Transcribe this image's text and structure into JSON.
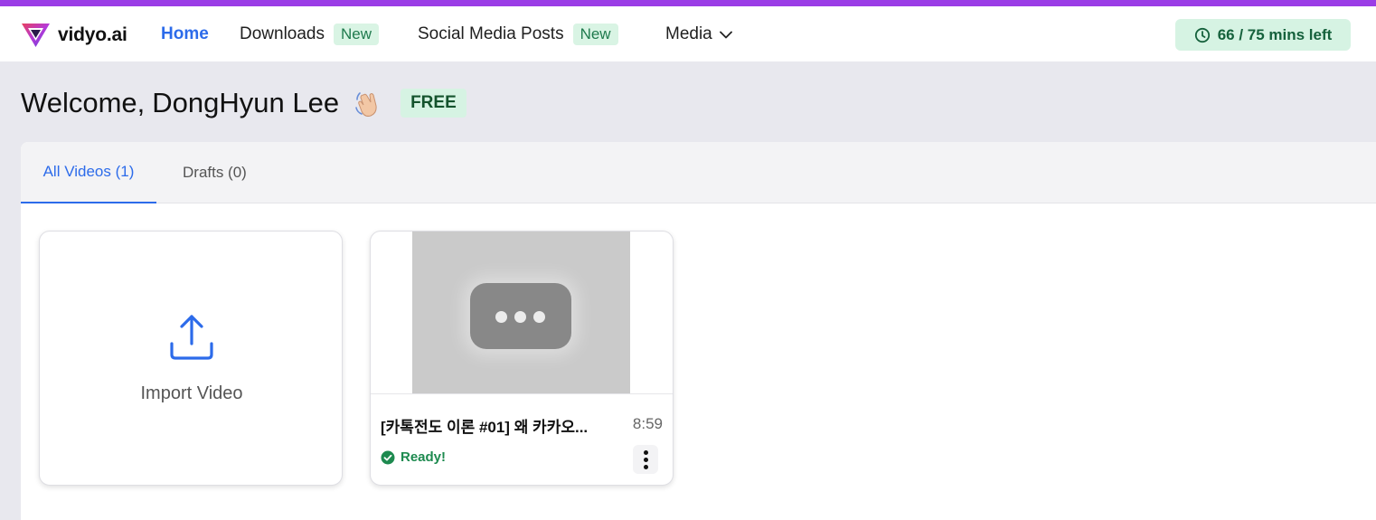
{
  "brand": {
    "name": "vidyo.ai",
    "accent_color": "#9b3de6",
    "primary_color": "#2c6bea",
    "success_color": "#1d8a4f"
  },
  "nav": {
    "home": "Home",
    "downloads": "Downloads",
    "downloads_badge": "New",
    "social": "Social Media Posts",
    "social_badge": "New",
    "media": "Media",
    "media_icon": "chevron-down-icon"
  },
  "usage": {
    "label": "66 / 75 mins left",
    "icon": "clock-icon"
  },
  "welcome": {
    "prefix": "Welcome,",
    "name": "DongHyun Lee",
    "emoji": "waving-hand-icon",
    "plan": "FREE"
  },
  "tabs": [
    {
      "label": "All Videos (1)",
      "active": true
    },
    {
      "label": "Drafts (0)",
      "active": false
    }
  ],
  "import_card": {
    "label": "Import Video",
    "icon": "upload-icon"
  },
  "videos": [
    {
      "title": "[카톡전도 이론 #01] 왜 카카오...",
      "duration": "8:59",
      "status": "Ready!",
      "status_icon": "check-circle-icon",
      "thumbnail_icon": "video-placeholder-icon",
      "menu_icon": "more-vertical-icon"
    }
  ]
}
